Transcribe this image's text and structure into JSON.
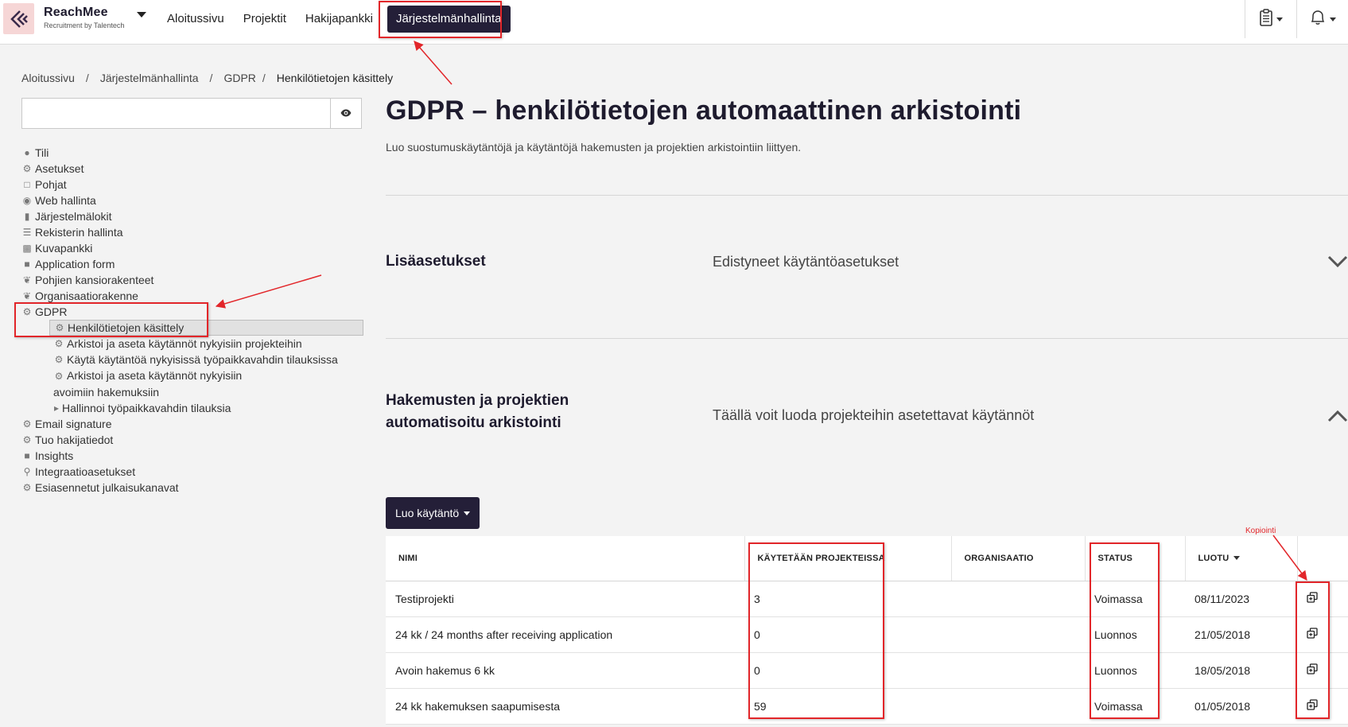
{
  "app": {
    "brand_name": "ReachMee",
    "brand_sub": "Recruitment by Talentech"
  },
  "nav": {
    "items": [
      {
        "label": "Aloitussivu"
      },
      {
        "label": "Projektit"
      },
      {
        "label": "Hakijapankki"
      },
      {
        "label": "Järjestelmänhallinta",
        "active": true
      }
    ],
    "right_icons": [
      "clipboard-icon",
      "bell-icon"
    ]
  },
  "breadcrumb": [
    "Aloitussivu",
    "Järjestelmänhallinta",
    "GDPR",
    "Henkilötietojen käsittely"
  ],
  "breadcrumb_sep": "/",
  "sidebar": {
    "search_value": "",
    "items": [
      {
        "label": "Tili",
        "icon": "users-icon"
      },
      {
        "label": "Asetukset",
        "icon": "gear-icon"
      },
      {
        "label": "Pohjat",
        "icon": "folder-open-icon"
      },
      {
        "label": "Web hallinta",
        "icon": "globe-icon"
      },
      {
        "label": "Järjestelmälokit",
        "icon": "book-icon"
      },
      {
        "label": "Rekisterin hallinta",
        "icon": "list-icon"
      },
      {
        "label": "Kuvapankki",
        "icon": "image-icon"
      },
      {
        "label": "Application form",
        "icon": "folder-icon"
      },
      {
        "label": "Pohjien kansiorakenteet",
        "icon": "leaf-icon"
      },
      {
        "label": "Organisaatiorakenne",
        "icon": "leaf-icon"
      },
      {
        "label": "GDPR",
        "icon": "gear-icon"
      }
    ],
    "gdpr_children": [
      {
        "label": "Henkilötietojen käsittely",
        "icon": "gear-icon",
        "selected": true
      },
      {
        "label": "Arkistoi ja aseta käytännöt nykyisiin projekteihin",
        "icon": "gear-icon"
      },
      {
        "label": "Käytä käytäntöä nykyisissä työpaikkavahdin tilauksissa",
        "icon": "gear-icon"
      },
      {
        "label": "Arkistoi ja aseta käytännöt nykyisiin avoimiin hakemuksiin",
        "icon": "gear-icon"
      },
      {
        "label": "Hallinnoi työpaikkavahdin tilauksia",
        "icon": "caret-right-icon"
      }
    ],
    "items_after": [
      {
        "label": "Email signature",
        "icon": "gear-icon"
      },
      {
        "label": "Tuo hakijatiedot",
        "icon": "gear-icon"
      },
      {
        "label": "Insights",
        "icon": "folder-icon"
      },
      {
        "label": "Integraatioasetukset",
        "icon": "key-icon"
      },
      {
        "label": "Esiasennetut julkaisukanavat",
        "icon": "gear-icon"
      }
    ]
  },
  "main": {
    "title": "GDPR – henkilötietojen automaattinen arkistointi",
    "description": "Luo suostumuskäytäntöjä ja käytäntöjä hakemusten ja projektien arkistointiin liittyen.",
    "section1": {
      "title": "Lisäasetukset",
      "description": "Edistyneet käytäntöasetukset"
    },
    "section2": {
      "title_line1": "Hakemusten ja projektien",
      "title_line2": "automatisoitu arkistointi",
      "description": "Täällä voit luoda projekteihin asetettavat käytännöt"
    },
    "create_button": "Luo käytäntö"
  },
  "table": {
    "headers": [
      "NIMI",
      "KÄYTETÄÄN PROJEKTEISSA",
      "ORGANISAATIO",
      "STATUS",
      "LUOTU"
    ],
    "rows": [
      {
        "name": "Testiprojekti",
        "used": "3",
        "org": "",
        "status": "Voimassa",
        "created": "08/11/2023"
      },
      {
        "name": "24 kk / 24 months after receiving application",
        "used": "0",
        "org": "",
        "status": "Luonnos",
        "created": "21/05/2018"
      },
      {
        "name": "Avoin hakemus 6 kk",
        "used": "0",
        "org": "",
        "status": "Luonnos",
        "created": "18/05/2018"
      },
      {
        "name": "24 kk hakemuksen saapumisesta",
        "used": "59",
        "org": "",
        "status": "Voimassa",
        "created": "01/05/2018"
      }
    ]
  },
  "annotation": {
    "label": "Kopiointi",
    "color": "#e2262a"
  },
  "colors": {
    "accent": "#241f38",
    "annotation": "#e2262a"
  }
}
